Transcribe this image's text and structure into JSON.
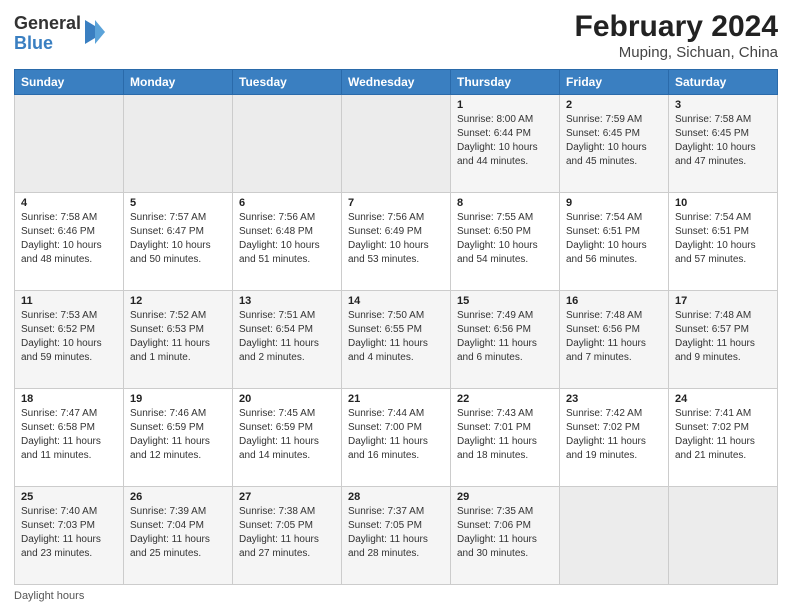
{
  "header": {
    "logo": {
      "general": "General",
      "blue": "Blue"
    },
    "title": "February 2024",
    "subtitle": "Muping, Sichuan, China"
  },
  "calendar": {
    "days_of_week": [
      "Sunday",
      "Monday",
      "Tuesday",
      "Wednesday",
      "Thursday",
      "Friday",
      "Saturday"
    ],
    "weeks": [
      [
        {
          "day": "",
          "empty": true
        },
        {
          "day": "",
          "empty": true
        },
        {
          "day": "",
          "empty": true
        },
        {
          "day": "",
          "empty": true
        },
        {
          "day": "1",
          "sunrise": "8:00 AM",
          "sunset": "6:44 PM",
          "daylight": "10 hours and 44 minutes."
        },
        {
          "day": "2",
          "sunrise": "7:59 AM",
          "sunset": "6:45 PM",
          "daylight": "10 hours and 45 minutes."
        },
        {
          "day": "3",
          "sunrise": "7:58 AM",
          "sunset": "6:45 PM",
          "daylight": "10 hours and 47 minutes."
        }
      ],
      [
        {
          "day": "4",
          "sunrise": "7:58 AM",
          "sunset": "6:46 PM",
          "daylight": "10 hours and 48 minutes."
        },
        {
          "day": "5",
          "sunrise": "7:57 AM",
          "sunset": "6:47 PM",
          "daylight": "10 hours and 50 minutes."
        },
        {
          "day": "6",
          "sunrise": "7:56 AM",
          "sunset": "6:48 PM",
          "daylight": "10 hours and 51 minutes."
        },
        {
          "day": "7",
          "sunrise": "7:56 AM",
          "sunset": "6:49 PM",
          "daylight": "10 hours and 53 minutes."
        },
        {
          "day": "8",
          "sunrise": "7:55 AM",
          "sunset": "6:50 PM",
          "daylight": "10 hours and 54 minutes."
        },
        {
          "day": "9",
          "sunrise": "7:54 AM",
          "sunset": "6:51 PM",
          "daylight": "10 hours and 56 minutes."
        },
        {
          "day": "10",
          "sunrise": "7:54 AM",
          "sunset": "6:51 PM",
          "daylight": "10 hours and 57 minutes."
        }
      ],
      [
        {
          "day": "11",
          "sunrise": "7:53 AM",
          "sunset": "6:52 PM",
          "daylight": "10 hours and 59 minutes."
        },
        {
          "day": "12",
          "sunrise": "7:52 AM",
          "sunset": "6:53 PM",
          "daylight": "11 hours and 1 minute."
        },
        {
          "day": "13",
          "sunrise": "7:51 AM",
          "sunset": "6:54 PM",
          "daylight": "11 hours and 2 minutes."
        },
        {
          "day": "14",
          "sunrise": "7:50 AM",
          "sunset": "6:55 PM",
          "daylight": "11 hours and 4 minutes."
        },
        {
          "day": "15",
          "sunrise": "7:49 AM",
          "sunset": "6:56 PM",
          "daylight": "11 hours and 6 minutes."
        },
        {
          "day": "16",
          "sunrise": "7:48 AM",
          "sunset": "6:56 PM",
          "daylight": "11 hours and 7 minutes."
        },
        {
          "day": "17",
          "sunrise": "7:48 AM",
          "sunset": "6:57 PM",
          "daylight": "11 hours and 9 minutes."
        }
      ],
      [
        {
          "day": "18",
          "sunrise": "7:47 AM",
          "sunset": "6:58 PM",
          "daylight": "11 hours and 11 minutes."
        },
        {
          "day": "19",
          "sunrise": "7:46 AM",
          "sunset": "6:59 PM",
          "daylight": "11 hours and 12 minutes."
        },
        {
          "day": "20",
          "sunrise": "7:45 AM",
          "sunset": "6:59 PM",
          "daylight": "11 hours and 14 minutes."
        },
        {
          "day": "21",
          "sunrise": "7:44 AM",
          "sunset": "7:00 PM",
          "daylight": "11 hours and 16 minutes."
        },
        {
          "day": "22",
          "sunrise": "7:43 AM",
          "sunset": "7:01 PM",
          "daylight": "11 hours and 18 minutes."
        },
        {
          "day": "23",
          "sunrise": "7:42 AM",
          "sunset": "7:02 PM",
          "daylight": "11 hours and 19 minutes."
        },
        {
          "day": "24",
          "sunrise": "7:41 AM",
          "sunset": "7:02 PM",
          "daylight": "11 hours and 21 minutes."
        }
      ],
      [
        {
          "day": "25",
          "sunrise": "7:40 AM",
          "sunset": "7:03 PM",
          "daylight": "11 hours and 23 minutes."
        },
        {
          "day": "26",
          "sunrise": "7:39 AM",
          "sunset": "7:04 PM",
          "daylight": "11 hours and 25 minutes."
        },
        {
          "day": "27",
          "sunrise": "7:38 AM",
          "sunset": "7:05 PM",
          "daylight": "11 hours and 27 minutes."
        },
        {
          "day": "28",
          "sunrise": "7:37 AM",
          "sunset": "7:05 PM",
          "daylight": "11 hours and 28 minutes."
        },
        {
          "day": "29",
          "sunrise": "7:35 AM",
          "sunset": "7:06 PM",
          "daylight": "11 hours and 30 minutes."
        },
        {
          "day": "",
          "empty": true
        },
        {
          "day": "",
          "empty": true
        }
      ]
    ]
  },
  "footer": {
    "daylight_label": "Daylight hours"
  }
}
